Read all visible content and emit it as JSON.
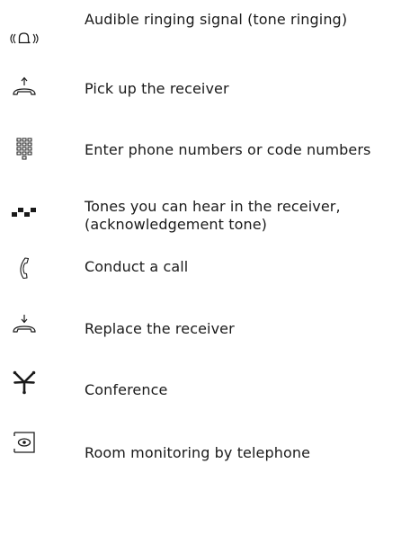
{
  "legend": {
    "items": [
      {
        "icon": "ringing-tone-icon",
        "text": "Audible ringing signal (tone ringing)"
      },
      {
        "icon": "pick-up-receiver-icon",
        "text": "Pick up the receiver"
      },
      {
        "icon": "keypad-icon",
        "text": "Enter phone numbers or code numbers"
      },
      {
        "icon": "acknowledgement-tone-icon",
        "text": "Tones you can hear in the receiver,\n(acknowledgement tone)"
      },
      {
        "icon": "handset-icon",
        "text": "Conduct a call"
      },
      {
        "icon": "replace-receiver-icon",
        "text": "Replace the receiver"
      },
      {
        "icon": "conference-icon",
        "text": "Conference"
      },
      {
        "icon": "room-monitoring-icon",
        "text": "Room monitoring by telephone"
      }
    ]
  }
}
